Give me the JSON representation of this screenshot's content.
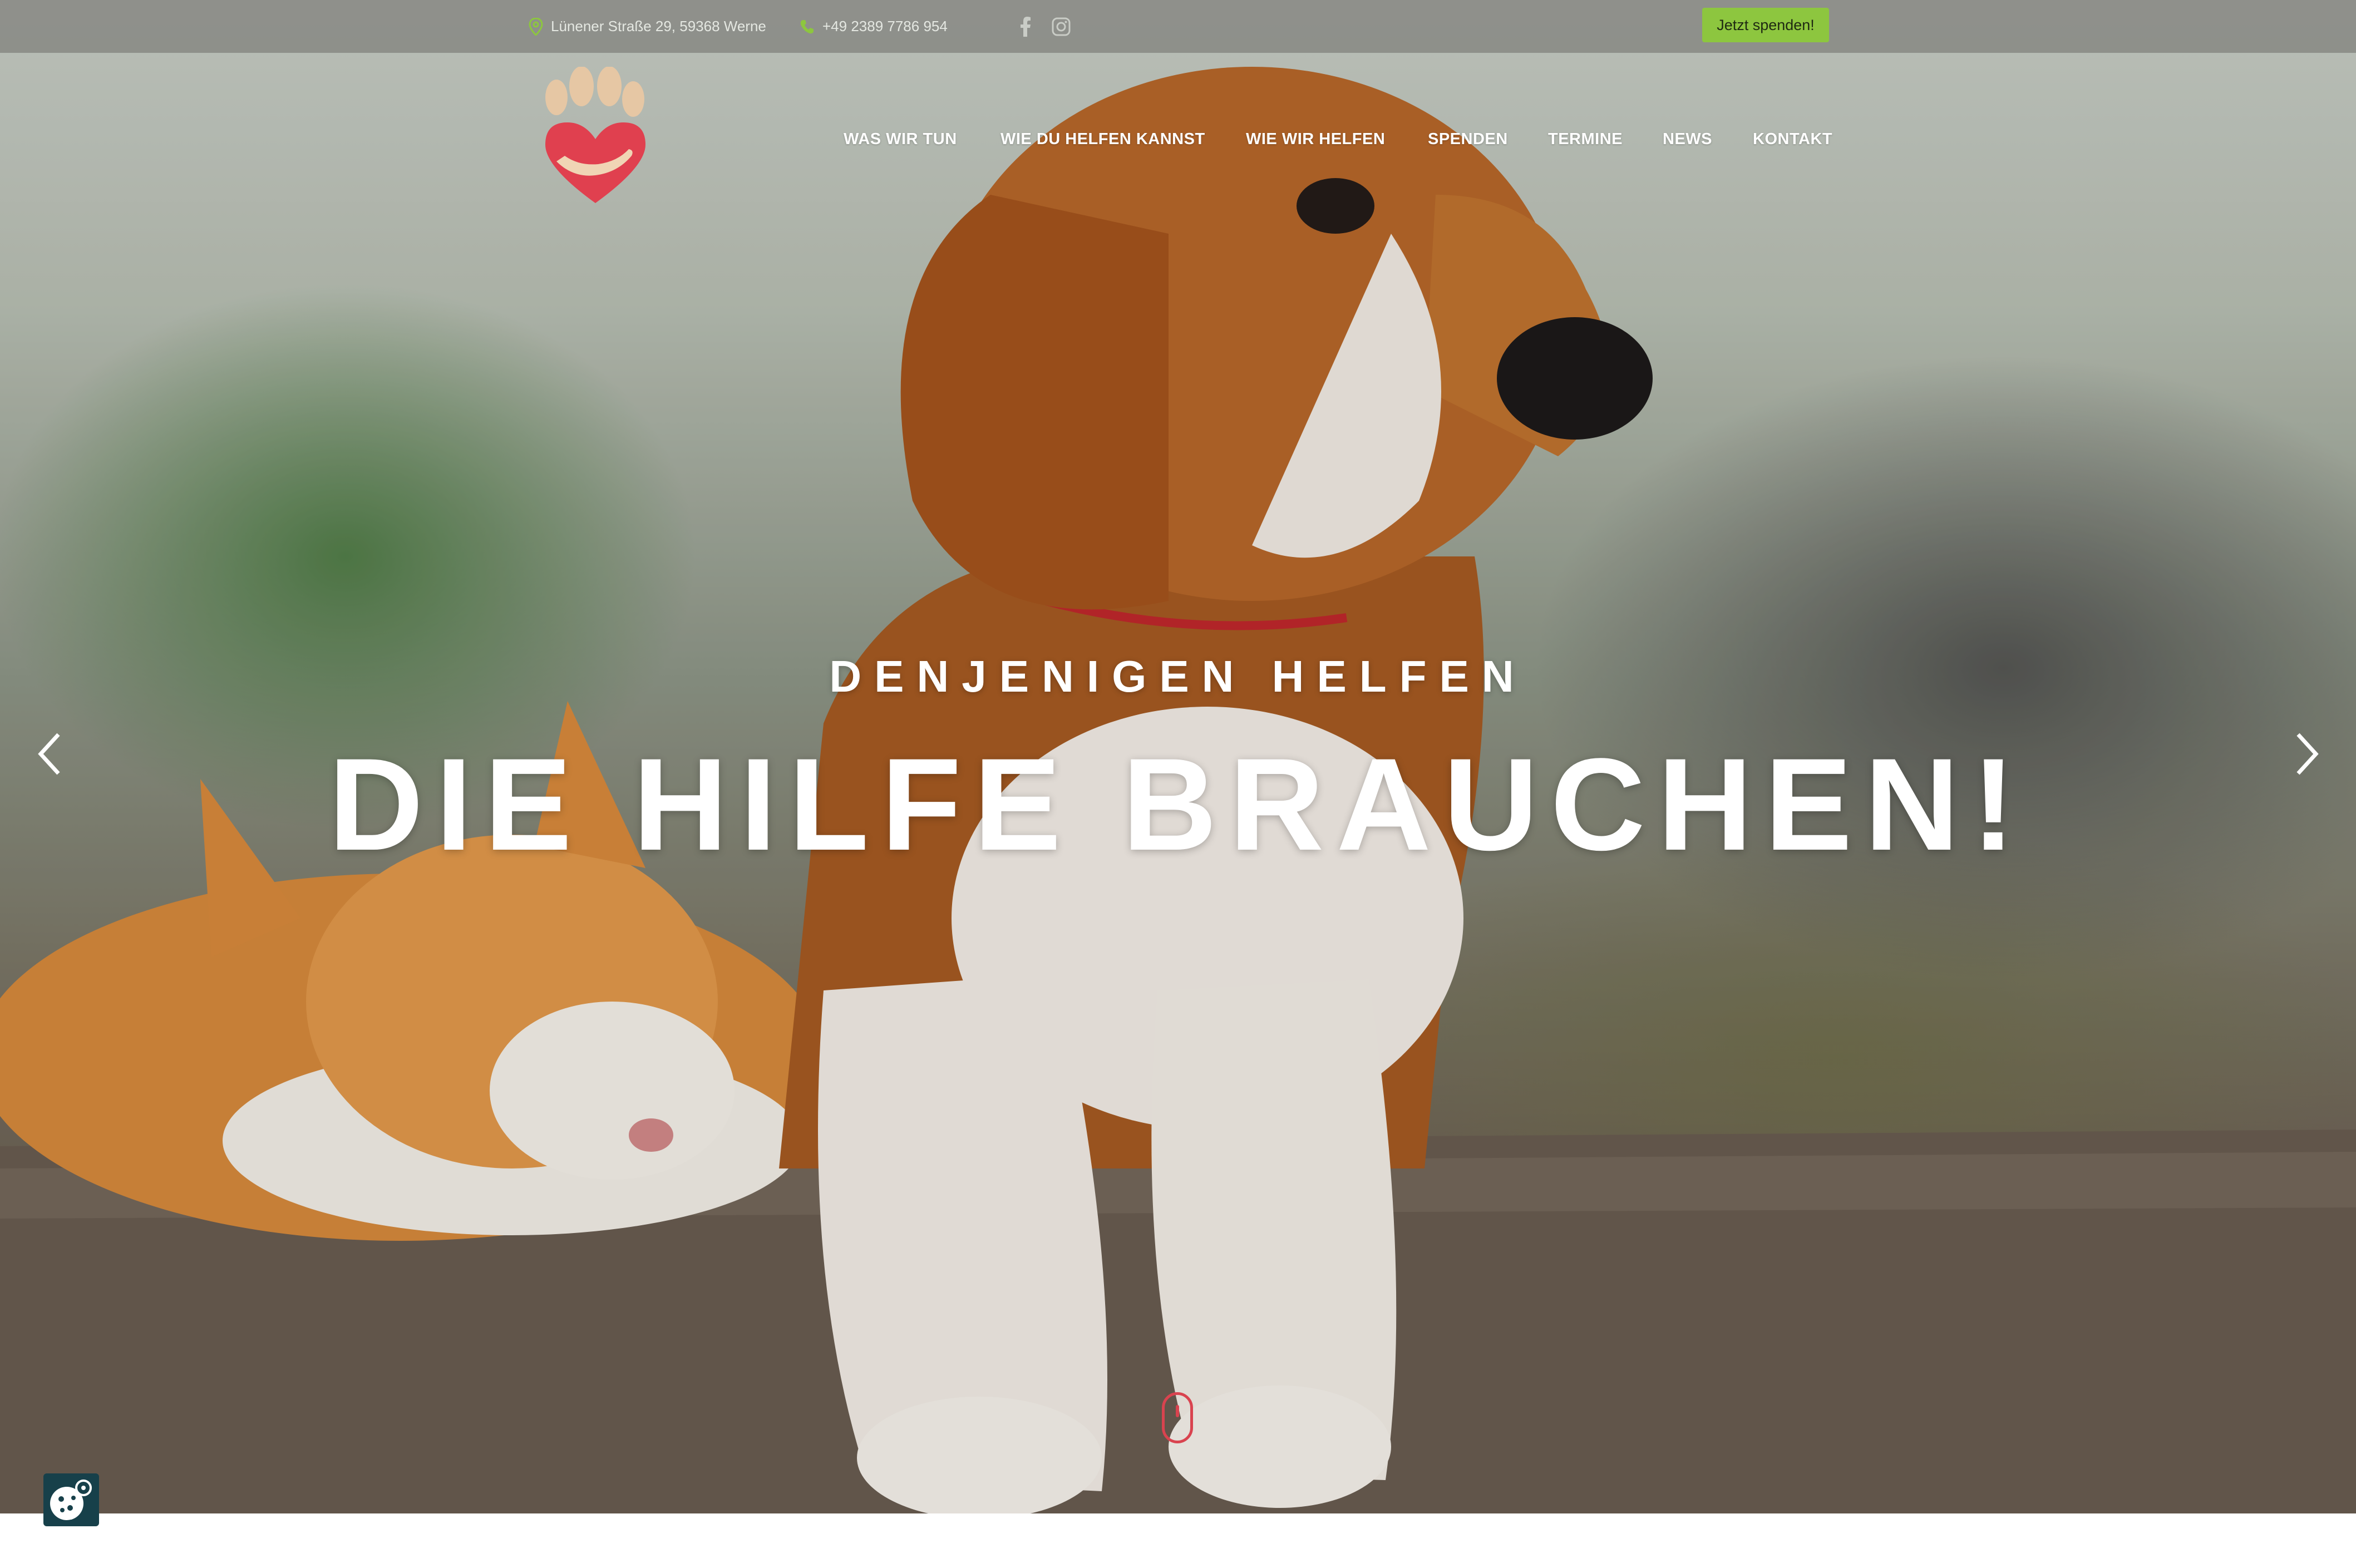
{
  "topbar": {
    "address": "Lünener Straße 29, 59368 Werne",
    "phone": "+49 2389 7786 954",
    "donate_label": "Jetzt spenden!"
  },
  "nav": {
    "items": [
      {
        "label": "WAS WIR TUN"
      },
      {
        "label": "WIE DU HELFEN KANNST"
      },
      {
        "label": "WIE WIR HELFEN"
      },
      {
        "label": "SPENDEN"
      },
      {
        "label": "TERMINE"
      },
      {
        "label": "NEWS"
      },
      {
        "label": "KONTAKT"
      }
    ]
  },
  "hero": {
    "subtitle": "DENJENIGEN HELFEN",
    "title": "DIE HILFE BRAUCHEN!"
  },
  "icons": {
    "address": "map-pin-icon",
    "phone": "phone-icon",
    "facebook": "facebook-icon",
    "instagram": "instagram-icon",
    "prev": "chevron-left-icon",
    "next": "chevron-right-icon",
    "cookie": "cookie-settings-icon",
    "scroll": "mouse-scroll-icon"
  },
  "colors": {
    "accent_green": "#8dc63f",
    "logo_red": "#e0404f",
    "logo_paw": "#e6c7a4",
    "cookie_bg": "#17404a"
  }
}
